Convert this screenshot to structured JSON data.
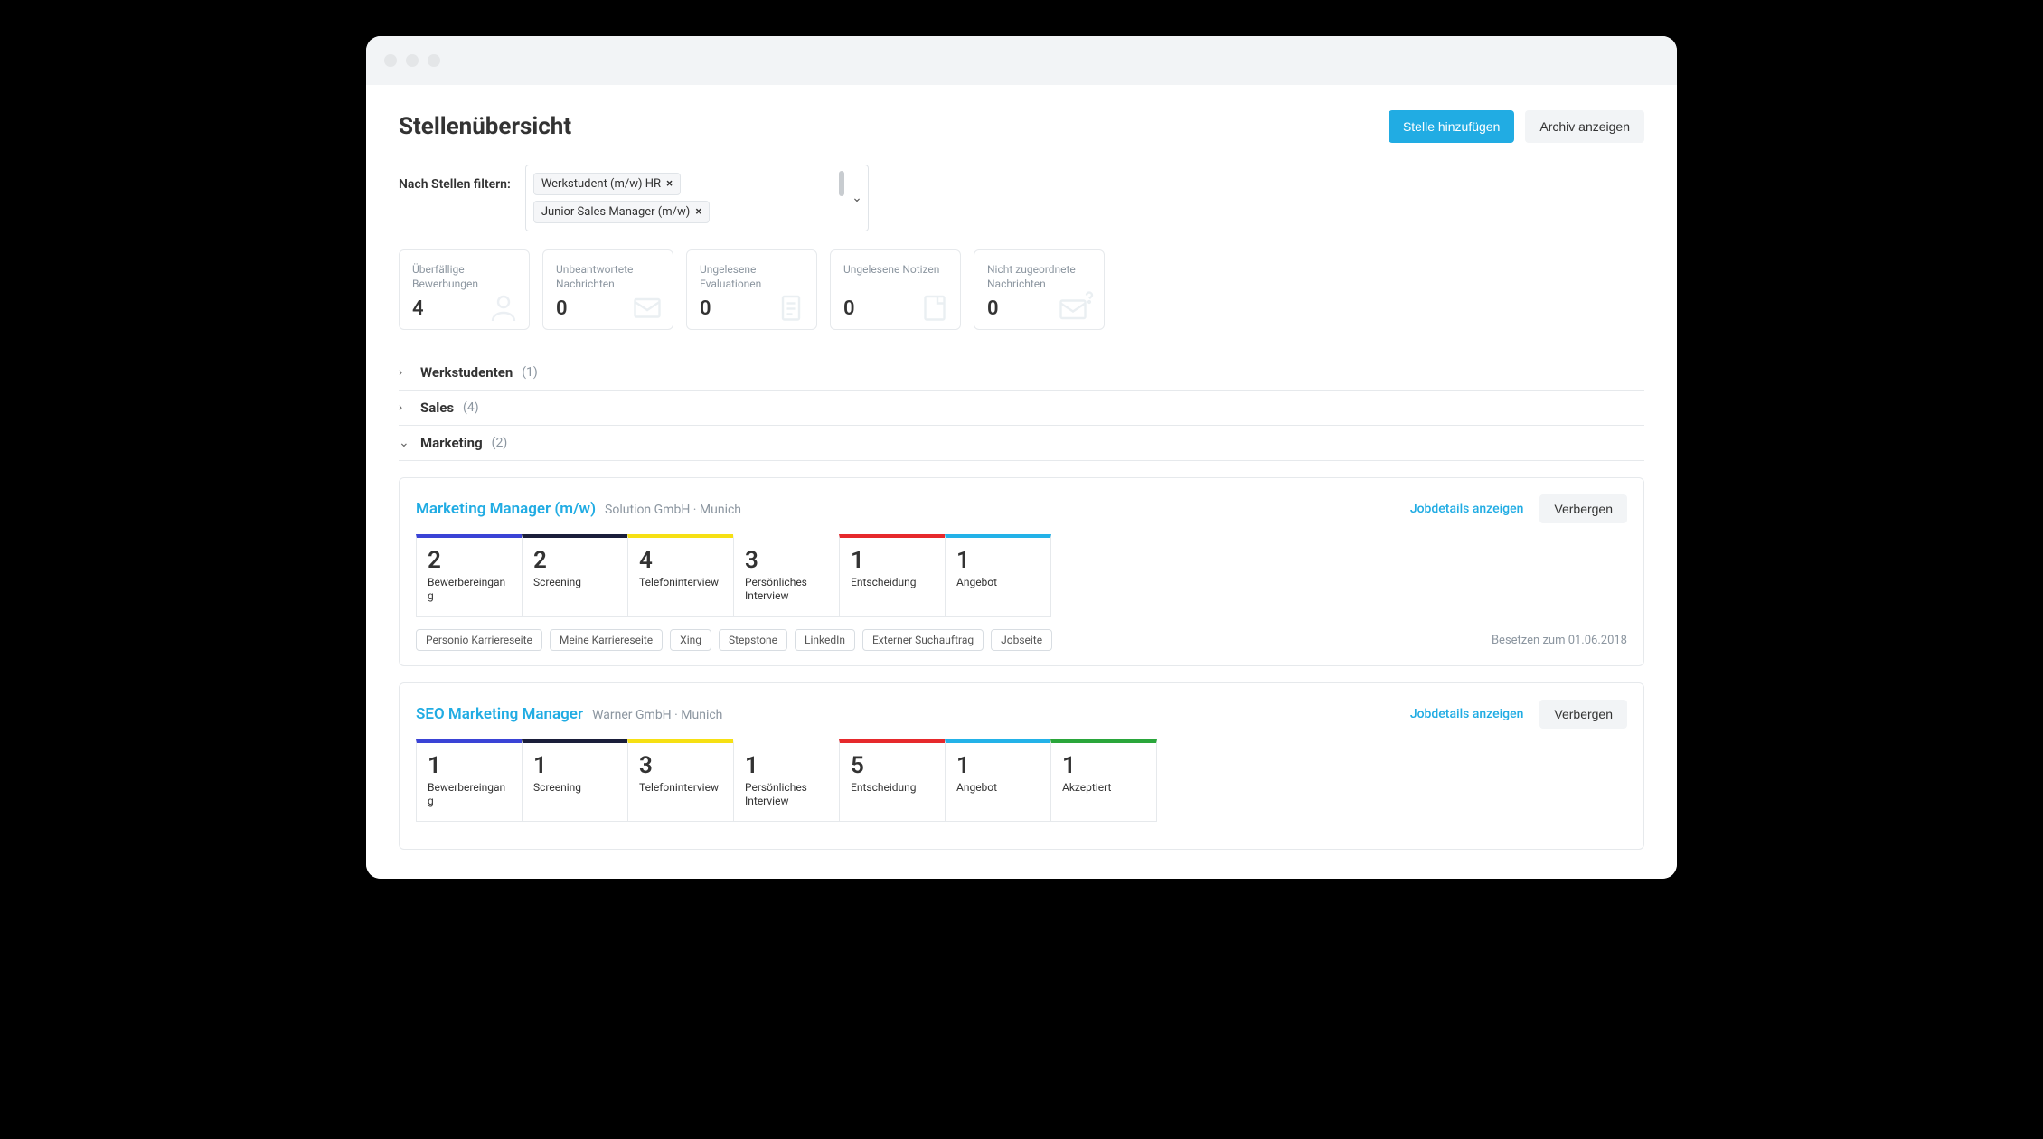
{
  "header": {
    "title": "Stellenübersicht",
    "add_button": "Stelle hinzufügen",
    "archive_button": "Archiv anzeigen"
  },
  "filter": {
    "label": "Nach Stellen filtern:",
    "chips": [
      "Werkstudent (m/w) HR",
      "Junior Sales Manager (m/w)"
    ]
  },
  "stats": [
    {
      "label": "Überfällige Bewerbungen",
      "value": "4",
      "icon": "user"
    },
    {
      "label": "Unbeantwortete Nachrichten",
      "value": "0",
      "icon": "envelope"
    },
    {
      "label": "Ungelesene Evaluationen",
      "value": "0",
      "icon": "clipboard"
    },
    {
      "label": "Ungelesene Notizen",
      "value": "0",
      "icon": "note"
    },
    {
      "label": "Nicht zugeordnete Nachrichten",
      "value": "0",
      "icon": "envelope-q"
    }
  ],
  "categories": [
    {
      "name": "Werkstudenten",
      "count": "(1)",
      "expanded": false
    },
    {
      "name": "Sales",
      "count": "(4)",
      "expanded": false
    },
    {
      "name": "Marketing",
      "count": "(2)",
      "expanded": true
    }
  ],
  "jobs": [
    {
      "title": "Marketing Manager (m/w)",
      "subtitle": "Solution GmbH · Munich",
      "details_link": "Jobdetails anzeigen",
      "hide_btn": "Verbergen",
      "stages": [
        {
          "count": "2",
          "label": "Bewerbereingang",
          "color": "#3a43d6"
        },
        {
          "count": "2",
          "label": "Screening",
          "color": "#1a1e3a"
        },
        {
          "count": "4",
          "label": "Telefoninterview",
          "color": "#f6e013"
        },
        {
          "count": "3",
          "label": "Persönliches Interview",
          "color": "#ffffff"
        },
        {
          "count": "1",
          "label": "Entscheidung",
          "color": "#e6292c"
        },
        {
          "count": "1",
          "label": "Angebot",
          "color": "#23b2e8"
        }
      ],
      "sources": [
        "Personio Karriereseite",
        "Meine Karriereseite",
        "Xing",
        "Stepstone",
        "LinkedIn",
        "Externer Suchauftrag",
        "Jobseite"
      ],
      "fill_by": "Besetzen zum 01.06.2018"
    },
    {
      "title": "SEO Marketing Manager",
      "subtitle": "Warner GmbH · Munich",
      "details_link": "Jobdetails anzeigen",
      "hide_btn": "Verbergen",
      "stages": [
        {
          "count": "1",
          "label": "Bewerbereingang",
          "color": "#3a43d6"
        },
        {
          "count": "1",
          "label": "Screening",
          "color": "#1a1e3a"
        },
        {
          "count": "3",
          "label": "Telefoninterview",
          "color": "#f6e013"
        },
        {
          "count": "1",
          "label": "Persönliches Interview",
          "color": "#ffffff"
        },
        {
          "count": "5",
          "label": "Entscheidung",
          "color": "#e6292c"
        },
        {
          "count": "1",
          "label": "Angebot",
          "color": "#23b2e8"
        },
        {
          "count": "1",
          "label": "Akzeptiert",
          "color": "#2aa63b"
        }
      ],
      "sources": [],
      "fill_by": ""
    }
  ]
}
